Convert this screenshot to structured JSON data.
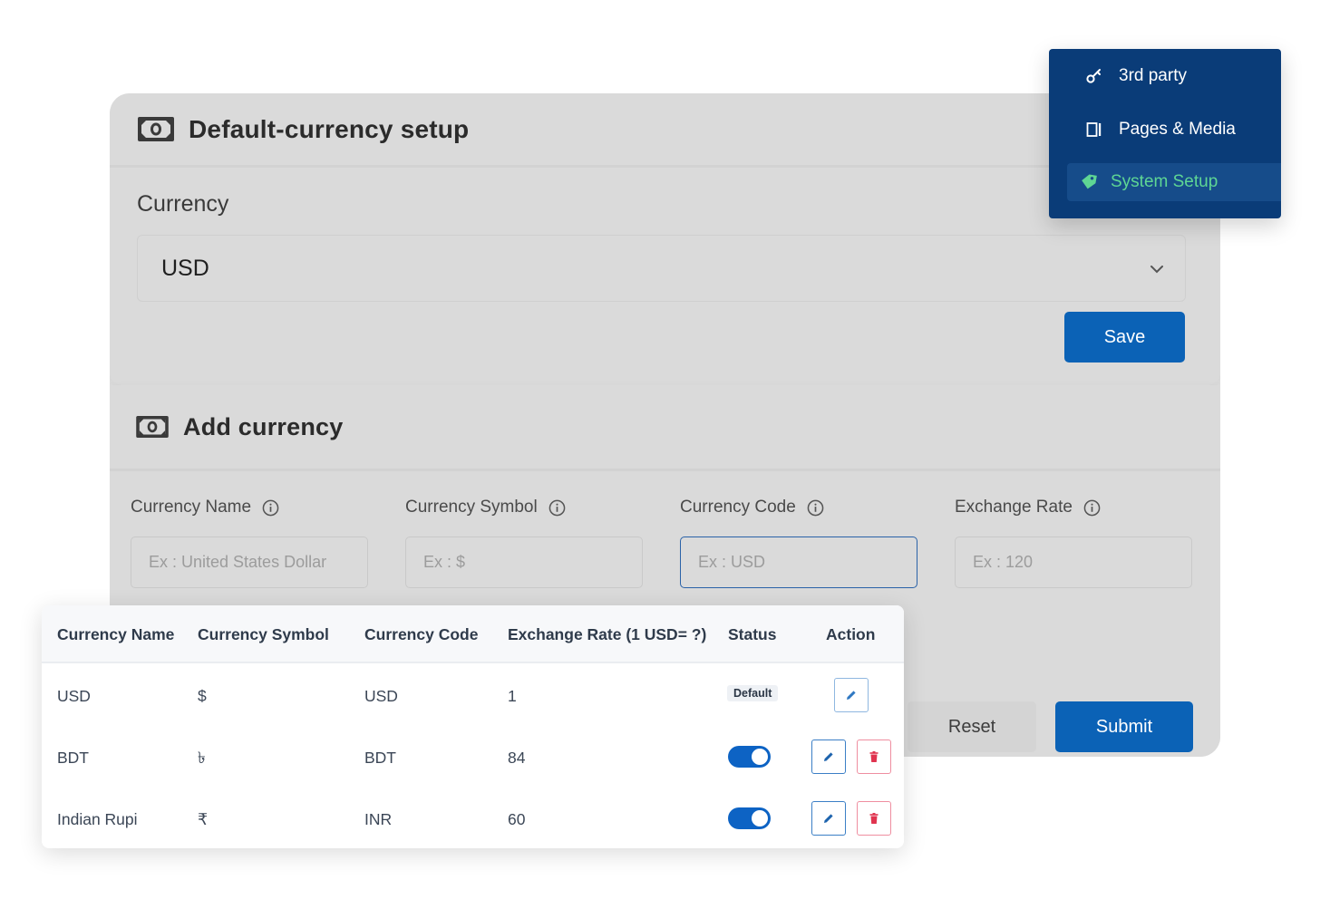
{
  "sidebar": {
    "items": [
      {
        "label": "3rd party",
        "icon": "key-icon",
        "active": false
      },
      {
        "label": "Pages & Media",
        "icon": "page-icon",
        "active": false
      },
      {
        "label": "System Setup",
        "icon": "tag-icon",
        "active": true
      }
    ],
    "active_color": "#5ed694",
    "background": "#0a3c78"
  },
  "default_currency": {
    "title": "Default-currency setup",
    "icon": "money-icon",
    "currency_label": "Currency",
    "selected_value": "USD",
    "save_label": "Save"
  },
  "add_currency": {
    "title": "Add currency",
    "icon": "money-icon",
    "fields": [
      {
        "label": "Currency Name",
        "placeholder": "Ex : United States Dollar"
      },
      {
        "label": "Currency Symbol",
        "placeholder": "Ex : $"
      },
      {
        "label": "Currency Code",
        "placeholder": "Ex : USD"
      },
      {
        "label": "Exchange Rate",
        "placeholder": "Ex : 120"
      }
    ],
    "reset_label": "Reset",
    "submit_label": "Submit"
  },
  "currency_table": {
    "headers": [
      "Currency Name",
      "Currency Symbol",
      "Currency Code",
      "Exchange Rate (1 USD= ?)",
      "Status",
      "Action"
    ],
    "rows": [
      {
        "name": "USD",
        "symbol": "$",
        "code": "USD",
        "rate": "1",
        "status": "Default",
        "status_type": "badge"
      },
      {
        "name": "BDT",
        "symbol": "৳",
        "code": "BDT",
        "rate": "84",
        "status": "on",
        "status_type": "toggle"
      },
      {
        "name": "Indian Rupi",
        "symbol": "₹",
        "code": "INR",
        "rate": "60",
        "status": "on",
        "status_type": "toggle"
      }
    ]
  },
  "colors": {
    "primary": "#0b62b6",
    "delete": "#e0344f",
    "toggle_on": "#0d63c4"
  }
}
